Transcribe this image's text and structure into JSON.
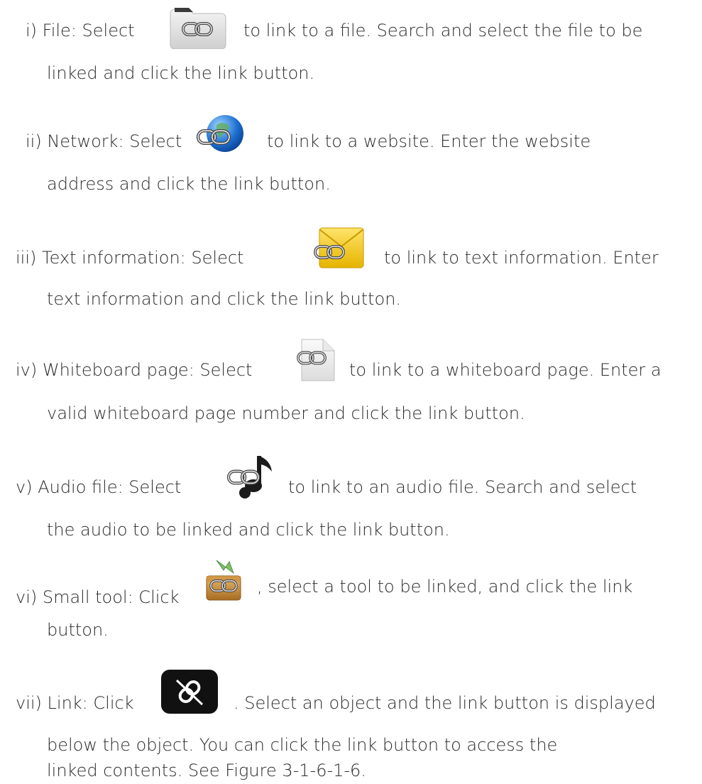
{
  "items": [
    {
      "line1_before": "i)  File: Select",
      "line1_after": "to link to a file. Search and select the file to be",
      "line2": "linked and click the link button.",
      "icon": "folder-link-icon"
    },
    {
      "line1_before": "ii)  Network: Select",
      "line1_after": "to link to a website. Enter the website",
      "line2": "address and click the link button.",
      "icon": "globe-link-icon"
    },
    {
      "line1_before": "iii)  Text information: Select",
      "line1_after": "to link to text information. Enter",
      "line2": "text information and click the link button.",
      "icon": "envelope-link-icon"
    },
    {
      "line1_before": "iv) Whiteboard page: Select",
      "line1_after": "to link to a whiteboard page. Enter a",
      "line2": "valid whiteboard page number and click the link button.",
      "icon": "page-link-icon"
    },
    {
      "line1_before": "v) Audio file: Select",
      "line1_after": "to link to an audio file. Search and select",
      "line2": "the audio to be linked and click the link button.",
      "icon": "audio-link-icon"
    },
    {
      "line1_before": "vi)  Small tool: Click",
      "line1_after": ", select a tool to be linked, and click the link",
      "line2": "button.",
      "icon": "toolbox-link-icon"
    },
    {
      "line1_before": "vii)  Link: Click",
      "line1_after": ". Select an object and the link button is displayed",
      "line2": "below the object. You can click the link button to access the",
      "line3": "linked contents. See Figure 3-1-6-1-6.",
      "icon": "link-button-icon"
    }
  ]
}
